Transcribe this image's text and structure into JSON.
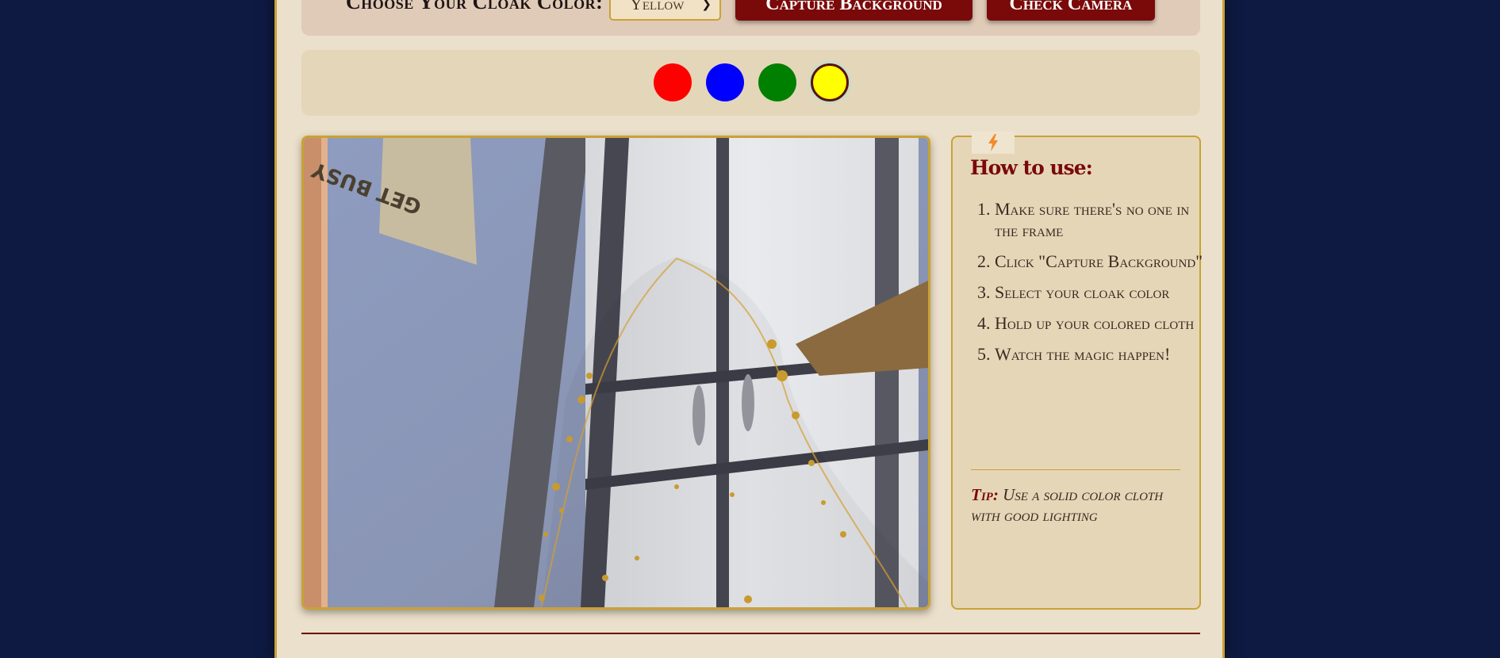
{
  "controls": {
    "cloak_label": "Choose Your Cloak Color:",
    "selected_color": "Yellow",
    "capture_button": "Capture Background",
    "check_camera_button": "Check Camera"
  },
  "swatches": [
    {
      "name": "red",
      "color": "#ff0000",
      "selected": false
    },
    {
      "name": "blue",
      "color": "#0000ff",
      "selected": false
    },
    {
      "name": "green",
      "color": "#008000",
      "selected": false
    },
    {
      "name": "yellow",
      "color": "#ffff00",
      "selected": true
    }
  ],
  "instructions": {
    "icon": "lightning-bolt-icon",
    "title": "How to use:",
    "steps": [
      "Make sure there's no one in the frame",
      "Click \"Capture Background\"",
      "Select your cloak color",
      "Hold up your colored cloth",
      "Watch the magic happen!"
    ],
    "tip_label": "Tip:",
    "tip_text": "Use a solid color cloth with good lighting"
  },
  "colors": {
    "page_background": "#0e1a42",
    "panel": "#ebe0cb",
    "accent_gold": "#c9a235",
    "button_red": "#7a0a0a"
  }
}
